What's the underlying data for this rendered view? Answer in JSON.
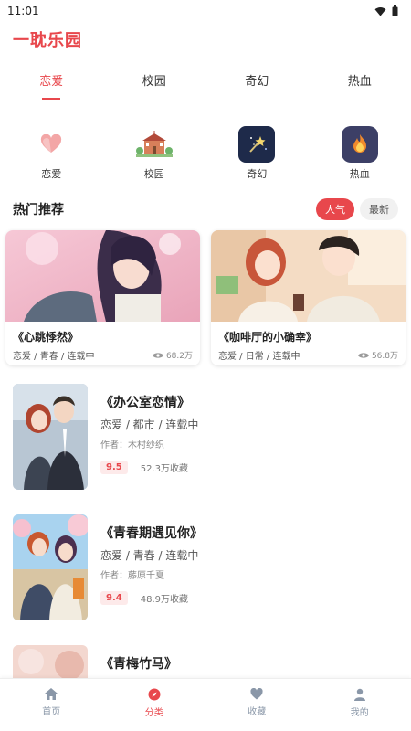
{
  "status": {
    "time": "11:01",
    "wifi_icon": "wifi-icon",
    "battery_icon": "battery-icon"
  },
  "app": {
    "title": "一耽乐园"
  },
  "tabs": [
    {
      "label": "恋爱",
      "active": true
    },
    {
      "label": "校园",
      "active": false
    },
    {
      "label": "奇幻",
      "active": false
    },
    {
      "label": "热血",
      "active": false
    }
  ],
  "categories": [
    {
      "label": "恋爱",
      "icon": "heart-icon"
    },
    {
      "label": "校园",
      "icon": "school-icon"
    },
    {
      "label": "奇幻",
      "icon": "magic-wand-icon"
    },
    {
      "label": "热血",
      "icon": "fire-icon"
    }
  ],
  "hot": {
    "title": "热门推荐",
    "sort": {
      "popular": "人气",
      "latest": "最新"
    }
  },
  "featured": [
    {
      "title": "《心跳悸然》",
      "tags": "恋爱 / 青春 / 连载中",
      "views": "68.2万"
    },
    {
      "title": "《咖啡厅的小确幸》",
      "tags": "恋爱 / 日常 / 连载中",
      "views": "56.8万"
    }
  ],
  "list": [
    {
      "title": "《办公室恋情》",
      "tags": "恋爱 / 都市 / 连载中",
      "author": "作者：木村纱织",
      "score": "9.5",
      "favs": "52.3万收藏"
    },
    {
      "title": "《青春期遇见你》",
      "tags": "恋爱 / 青春 / 连载中",
      "author": "作者：藤原千夏",
      "score": "9.4",
      "favs": "48.9万收藏"
    },
    {
      "title": "《青梅竹马》"
    }
  ],
  "nav": [
    {
      "label": "首页",
      "icon": "home-icon",
      "active": false
    },
    {
      "label": "分类",
      "icon": "compass-icon",
      "active": true
    },
    {
      "label": "收藏",
      "icon": "heart-icon",
      "active": false
    },
    {
      "label": "我的",
      "icon": "user-icon",
      "active": false
    }
  ],
  "colors": {
    "accent": "#e8474c",
    "nav_inactive": "#8a97a8"
  }
}
